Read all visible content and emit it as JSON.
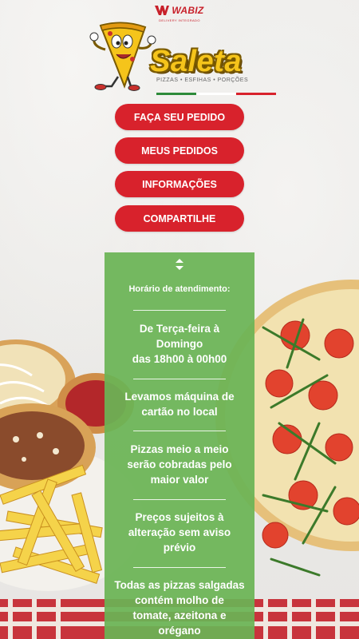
{
  "brand": {
    "wabiz_name": "WABIZ",
    "wabiz_tagline": "DELIVERY INTEGRADO",
    "restaurant_name": "Saleta",
    "tagline": "PIZZAS • ESFIHAS • PORÇÕES",
    "colors": {
      "red": "#d8222c",
      "yellow": "#f5c41b",
      "green": "#6ab455"
    }
  },
  "menu": {
    "items": [
      {
        "label": "FAÇA SEU PEDIDO"
      },
      {
        "label": "MEUS PEDIDOS"
      },
      {
        "label": "INFORMAÇÕES"
      },
      {
        "label": "COMPARTILHE"
      }
    ]
  },
  "info": {
    "toggle_icon": "up-down-arrows-icon",
    "title": "Horário de atendimento:",
    "blocks": [
      [
        "De Terça-feira à",
        "Domingo",
        "das 18h00 à 00h00"
      ],
      [
        "Levamos máquina de",
        "cartão no local"
      ],
      [
        "Pizzas meio a meio",
        "serão cobradas pelo",
        "maior valor"
      ],
      [
        "Preços sujeitos à",
        "alteração sem aviso",
        "prévio"
      ],
      [
        "Todas as pizzas salgadas",
        "contém molho de",
        "tomate, azeitona e",
        "orégano"
      ]
    ]
  }
}
